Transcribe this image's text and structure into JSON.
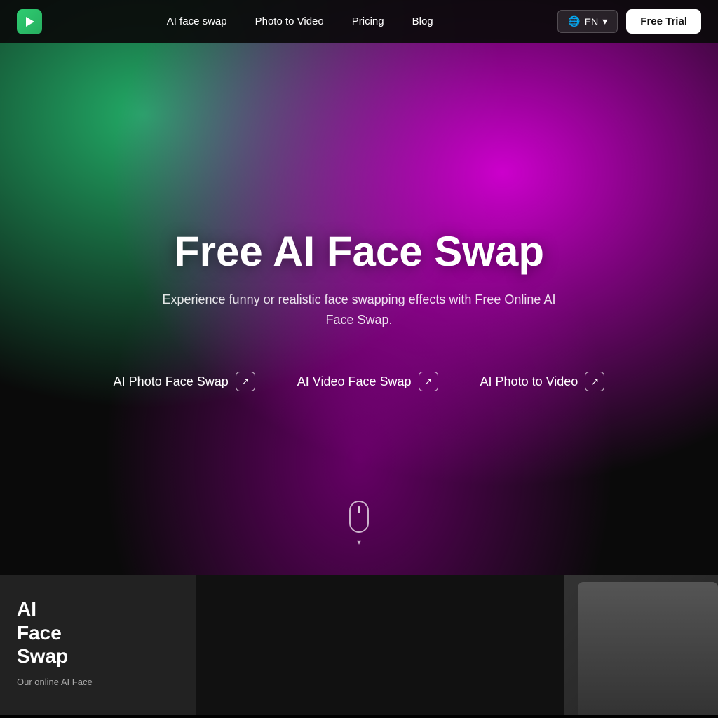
{
  "navbar": {
    "logo_alt": "PixVerse",
    "links": [
      {
        "id": "ai-face-swap",
        "label": "AI face swap"
      },
      {
        "id": "photo-to-video",
        "label": "Photo to Video"
      },
      {
        "id": "pricing",
        "label": "Pricing"
      },
      {
        "id": "blog",
        "label": "Blog"
      }
    ],
    "lang_label": "EN",
    "free_trial_label": "Free Trial"
  },
  "hero": {
    "title": "Free AI Face Swap",
    "subtitle": "Experience funny or realistic face swapping effects with Free Online AI Face Swap.",
    "links": [
      {
        "id": "photo-face-swap",
        "label": "AI Photo Face Swap"
      },
      {
        "id": "video-face-swap",
        "label": "AI Video Face Swap"
      },
      {
        "id": "photo-to-video",
        "label": "AI Photo to Video"
      }
    ]
  },
  "bottom_section": {
    "title": "AI\nFace\nSwap",
    "description": "Our online AI Face"
  },
  "icons": {
    "arrow_up_right": "↗",
    "chevron_down": "▾",
    "globe": "🌐",
    "scroll_down": "▾"
  }
}
